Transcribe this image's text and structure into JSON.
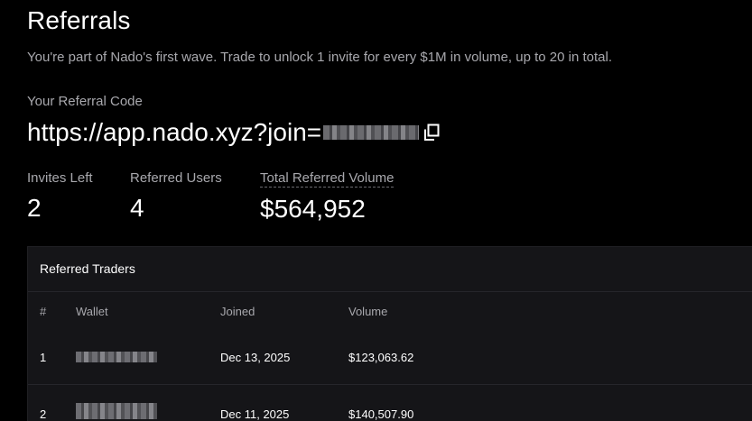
{
  "header": {
    "title": "Referrals",
    "subtitle": "You're part of Nado's first wave. Trade to unlock 1 invite for every $1M in volume, up to 20 in total."
  },
  "referral_code": {
    "label": "Your Referral Code",
    "url_prefix": "https://app.nado.xyz?join=",
    "copy_icon": "copy-icon"
  },
  "stats": {
    "invites_left": {
      "label": "Invites Left",
      "value": "2"
    },
    "referred_users": {
      "label": "Referred Users",
      "value": "4"
    },
    "total_volume": {
      "label": "Total Referred Volume",
      "value": "$564,952"
    }
  },
  "table": {
    "title": "Referred Traders",
    "headers": {
      "index": "#",
      "wallet": "Wallet",
      "joined": "Joined",
      "volume": "Volume"
    },
    "rows": [
      {
        "index": "1",
        "joined": "Dec 13, 2025",
        "volume": "$123,063.62"
      },
      {
        "index": "2",
        "joined": "Dec 11, 2025",
        "volume": "$140,507.90"
      }
    ]
  },
  "colors": {
    "background": "#000000",
    "card": "#151518",
    "muted_text": "#a8a8ad",
    "text": "#ffffff"
  }
}
